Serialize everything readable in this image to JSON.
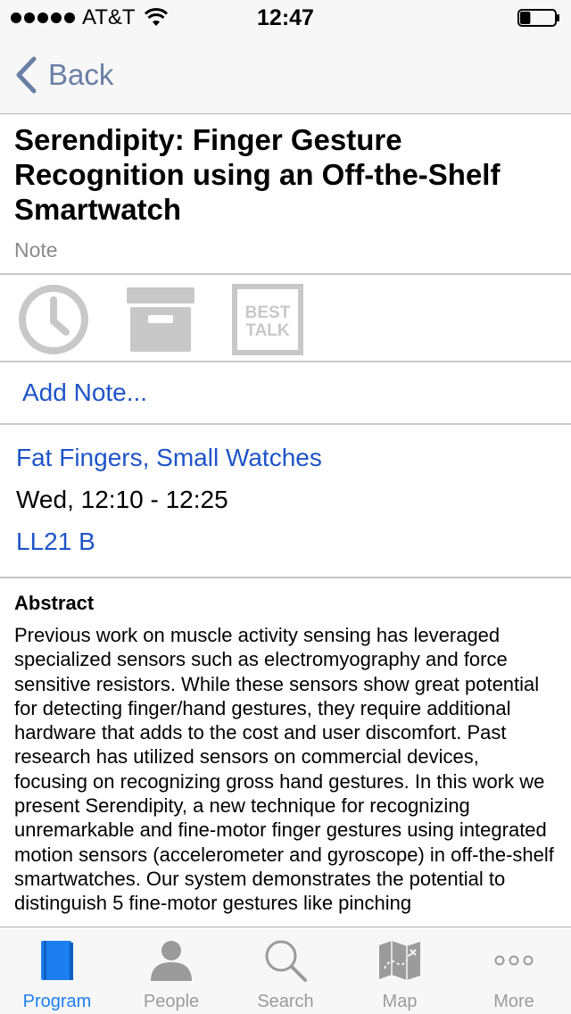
{
  "status_bar": {
    "carrier": "AT&T",
    "time": "12:47",
    "signal_bars": 5,
    "battery_level": 0.3
  },
  "nav": {
    "back_label": "Back"
  },
  "item": {
    "title": "Serendipity: Finger Gesture Recognition using an Off-the-Shelf Smartwatch",
    "type": "Note"
  },
  "actions": {
    "icons": [
      "clock-icon",
      "archive-box-icon",
      "best-talk-icon"
    ],
    "best_talk_line1": "BEST",
    "best_talk_line2": "TALK",
    "add_note_label": "Add Note..."
  },
  "session": {
    "name": "Fat Fingers, Small Watches",
    "time": "Wed, 12:10 - 12:25",
    "room": "LL21 B"
  },
  "abstract": {
    "heading": "Abstract",
    "text": "Previous work on muscle activity sensing has leveraged specialized sensors such as electromyography and force sensitive resistors. While these sensors show great potential for detecting finger/hand gestures, they require additional hardware that adds to the cost and user discomfort. Past research has utilized sensors on commercial devices, focusing on recognizing gross hand gestures. In this work we present Serendipity, a new technique for recognizing unremarkable and fine-motor finger gestures using integrated motion sensors (accelerometer and gyroscope) in off-the-shelf smartwatches. Our system demonstrates the potential to distinguish 5 fine-motor gestures like pinching"
  },
  "tabs": [
    {
      "label": "Program",
      "icon": "book-icon",
      "active": true
    },
    {
      "label": "People",
      "icon": "person-icon",
      "active": false
    },
    {
      "label": "Search",
      "icon": "search-icon",
      "active": false
    },
    {
      "label": "Map",
      "icon": "map-icon",
      "active": false
    },
    {
      "label": "More",
      "icon": "more-icon",
      "active": false
    }
  ],
  "colors": {
    "link_blue": "#1f54c7",
    "tab_active": "#1c7ef0",
    "tab_inactive": "#9b9b9b",
    "icon_gray": "#c8c8c8",
    "back_gray_blue": "#6a7fa6"
  }
}
